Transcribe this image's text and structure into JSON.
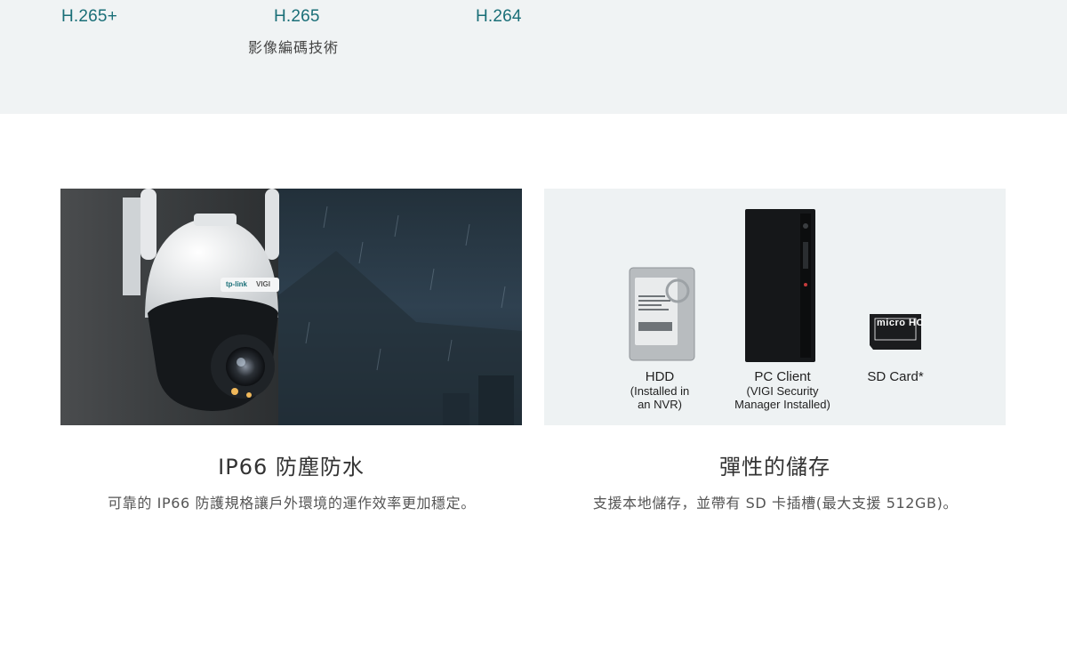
{
  "codecs": {
    "items": [
      {
        "label": "H.265+"
      },
      {
        "label": "H.265"
      },
      {
        "label": "H.264"
      }
    ],
    "subtitle": "影像編碼技術"
  },
  "features": [
    {
      "title": "IP66 防塵防水",
      "description": "可靠的 IP66 防護規格讓戶外環境的運作效率更加穩定。",
      "camera_brand": "tp-link",
      "camera_series": "VIGI"
    },
    {
      "title": "彈性的儲存",
      "description": "支援本地儲存，並帶有 SD 卡插槽(最大支援 512GB)。",
      "storage": [
        {
          "name": "HDD",
          "note_line1": "(Installed in",
          "note_line2": "an NVR)"
        },
        {
          "name": "PC Client",
          "note_line1": "(VIGI Security",
          "note_line2": "Manager Installed)"
        },
        {
          "name": "SD Card*",
          "note_line1": "",
          "note_line2": ""
        }
      ],
      "sd_logo": "micro HC"
    }
  ]
}
